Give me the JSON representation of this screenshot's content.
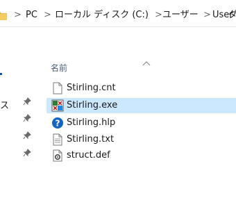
{
  "breadcrumb": {
    "segments": [
      "PC",
      "ローカル ディスク (C:)",
      "ユーザー",
      "User",
      "ダ"
    ],
    "separator": ">"
  },
  "nav_pane": {
    "partial_label": "ス"
  },
  "file_list": {
    "column_header": "名前",
    "items": [
      {
        "name": "Stirling.cnt",
        "icon": "document-icon",
        "selected": false
      },
      {
        "name": "Stirling.exe",
        "icon": "application-icon",
        "selected": true
      },
      {
        "name": "Stirling.hlp",
        "icon": "help-file-icon",
        "selected": false
      },
      {
        "name": "Stirling.txt",
        "icon": "text-file-icon",
        "selected": false
      },
      {
        "name": "struct.def",
        "icon": "settings-file-icon",
        "selected": false
      }
    ]
  },
  "colors": {
    "selection": "#cce8ff",
    "header_text": "#4c607a",
    "folder": "#e8b84a",
    "help_blue": "#1565c0"
  }
}
